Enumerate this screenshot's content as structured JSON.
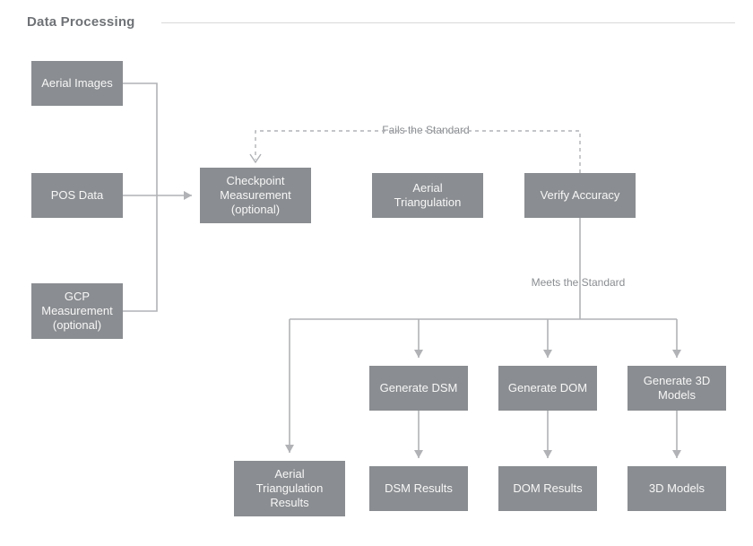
{
  "title": "Data Processing",
  "inputs": {
    "aerial_images": "Aerial\nImages",
    "pos_data": "POS\nData",
    "gcp_measurement": "GCP\nMeasurement\n(optional)"
  },
  "stages": {
    "checkpoint": "Checkpoint\nMeasurement\n(optional)",
    "aerial_tri": "Aerial\nTriangulation",
    "verify": "Verify\nAccuracy"
  },
  "edges": {
    "fail": "Fails the Standard",
    "meet": "Meets the Standard"
  },
  "outputs": {
    "gen_dsm": "Generate\nDSM",
    "gen_dom": "Generate\nDOM",
    "gen_3d": "Generate 3D\nModels",
    "at_results": "Aerial\nTriangulation\nResults",
    "dsm_results": "DSM\nResults",
    "dom_results": "DOM\nResults",
    "models_3d": "3D\nModels"
  }
}
